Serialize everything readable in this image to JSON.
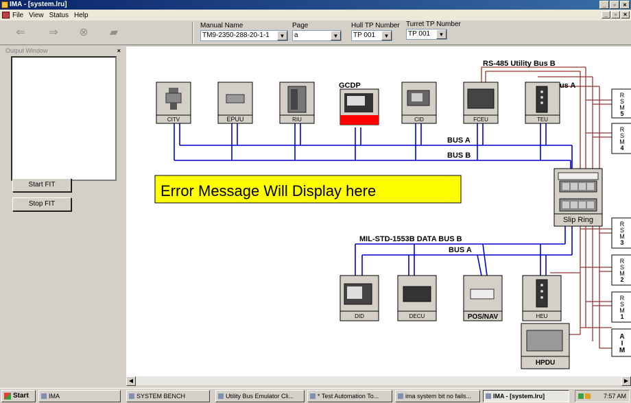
{
  "window": {
    "title": "IMA - [system.lru]",
    "controls": [
      "_",
      "▫",
      "×"
    ]
  },
  "menu": {
    "items": [
      "File",
      "View",
      "Status",
      "Help"
    ],
    "mdi_controls": [
      "_",
      "▫",
      "×"
    ]
  },
  "toolbar": {
    "icons": [
      "back-arrow-icon",
      "forward-arrow-icon",
      "stop-icon",
      "print-icon"
    ],
    "manual_label": "Manual Name",
    "manual_value": "TM9-2350-288-20-1-1",
    "page_label": "Page",
    "page_value": "a",
    "hull_label": "Hull TP Number",
    "hull_value": "TP 001",
    "turret_label": "Turret TP Number",
    "turret_value": "TP 001"
  },
  "left_pane": {
    "output_title": "Output Window",
    "close": "×",
    "start_fit": "Start FIT",
    "stop_fit": "Stop FIT"
  },
  "diagram": {
    "error_message": "Error Message Will Display here",
    "top_units": [
      "CITV",
      "EPUU",
      "RIU",
      "GCDP",
      "CID",
      "FCEU",
      "TEU"
    ],
    "bottom_units": [
      "DID",
      "DECU",
      "POS/NAV",
      "HEU",
      "HPDU"
    ],
    "buses": {
      "rs485": "RS-485 Utility Bus B",
      "bus_a_small": "Bus A",
      "bus_a": "BUS A",
      "bus_b": "BUS B",
      "mil_std": "MIL-STD-1553B DATA BUS B",
      "bus_a_lower": "BUS A"
    },
    "slip_ring": "Slip Ring",
    "rsm_boxes": [
      "RSM5",
      "RSM4",
      "RSM3",
      "RSM2",
      "RSM1",
      "AIM"
    ],
    "colors": {
      "bus": "#0000cc",
      "utility": "#993333",
      "error_bg": "#ffff00",
      "gcdp_bar": "#ff0000"
    }
  },
  "taskbar": {
    "start": "Start",
    "tasks": [
      "IMA",
      "SYSTEM BENCH",
      "Utility Bus Emulator Cli...",
      "* Test Automation To...",
      "ima system bit no fails...",
      "IMA - [system.lru]"
    ],
    "clock": "7:57 AM"
  }
}
